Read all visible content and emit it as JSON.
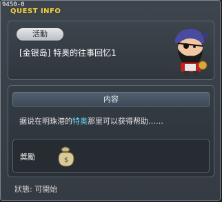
{
  "window": {
    "quest_id": "9450-0",
    "title": "QUEST INFO"
  },
  "quest": {
    "category_badge": "活動",
    "name": "[金银岛] 特奥的往事回忆1",
    "npc_icon": "pirate-npc-icon"
  },
  "content": {
    "header": "内容",
    "text_before": "据说在明珠港的",
    "text_highlight": "特奥",
    "text_after": "那里可以获得帮助……",
    "highlight_color": "#66d8ff"
  },
  "reward": {
    "label": "獎勵",
    "item_icon": "money-bag-icon"
  },
  "status": {
    "text": "狀態:  可開始"
  },
  "colors": {
    "title": "#f5d23a",
    "window_bg": "#3a4148"
  }
}
